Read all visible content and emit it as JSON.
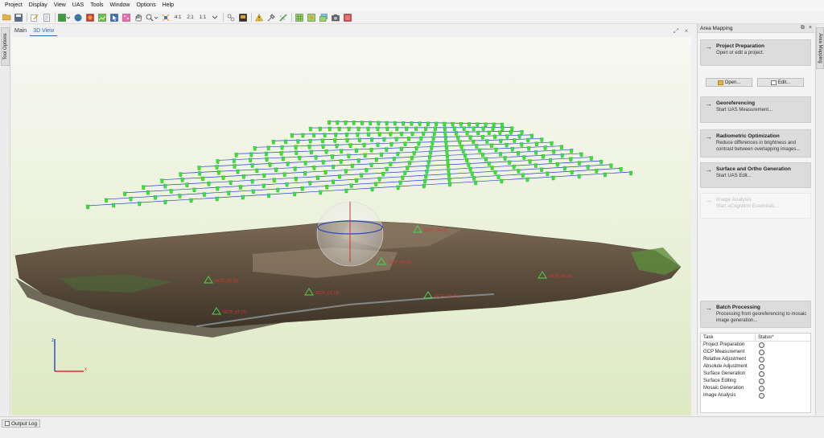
{
  "menu": [
    "Project",
    "Display",
    "View",
    "UAS",
    "Tools",
    "Window",
    "Options",
    "Help"
  ],
  "toolbar": {
    "icons": [
      "open-folder-icon",
      "save-icon",
      "edit-icon",
      "document-icon",
      "layer-dropdown-icon",
      "globe-icon",
      "image-icon",
      "ortho-image-icon",
      "cursor-icon",
      "point-cloud-icon",
      "pan-hand-icon",
      "zoom-dropdown-icon",
      "crosshair-icon"
    ],
    "zoom_labels": [
      "4:1",
      "2:1",
      "1:1"
    ],
    "icons_after": [
      "link-icon",
      "export-icon",
      "warning-icon",
      "tool-icon",
      "measure-icon",
      "grid-icon",
      "grid-alt-icon",
      "image-stack-icon",
      "camera-icon",
      "gcp-icon"
    ],
    "colors": {
      "blue": "#3a6fb7",
      "green": "#3c9b3c",
      "orange": "#e0a12e",
      "red": "#c84242"
    }
  },
  "left_dock": {
    "label": "Tool Options"
  },
  "view_tabs": [
    {
      "label": "Main"
    },
    {
      "label": "3D View"
    }
  ],
  "active_tab": "3D View",
  "scene": {
    "gcp_labels": [
      "GCP_04 (1)",
      "GCP_05 (2)",
      "GCP_01 (3)",
      "GCP_02 (4)",
      "GCP_03 (5)",
      "GCP_06 (6)",
      "GCP_07 (7)"
    ],
    "axis_labels": {
      "x": "x",
      "z": "z"
    },
    "colors": {
      "camera_green": "#33e833",
      "flight_line": "#2442d6",
      "gcp_text": "#e03232"
    }
  },
  "panel": {
    "title": "Area Mapping",
    "project_prep": {
      "title": "Project Preparation",
      "subtitle": "Open or edit a project."
    },
    "open_button": "Open...",
    "edit_button": "Edit...",
    "georef": {
      "title": "Georeferencing",
      "subtitle": "Start UAS Measurement..."
    },
    "radiometric": {
      "title": "Radiometric Optimization",
      "subtitle": "Reduce differences in brightness and contrast between overlapping images..."
    },
    "surface": {
      "title": "Surface and Ortho Generation",
      "subtitle": "Start UAS Edit..."
    },
    "image_analysis": {
      "title": "Image Analysis",
      "subtitle": "Start eCognition Essentials..."
    },
    "batch": {
      "title": "Batch Processing",
      "subtitle": "Processing from georeferencing to mosaic image generation..."
    },
    "table": {
      "headers": [
        "Task",
        "Status*"
      ],
      "rows": [
        "Project Preparation",
        "GCP Measurement",
        "Relative Adjustment",
        "Absolute Adjustment",
        "Surface Generation",
        "Surface Editing",
        "Mosaic Generation",
        "Image Analysis"
      ]
    }
  },
  "right_dock": {
    "label": "Area Mapping"
  },
  "status": {
    "output_log": "Output Log"
  }
}
